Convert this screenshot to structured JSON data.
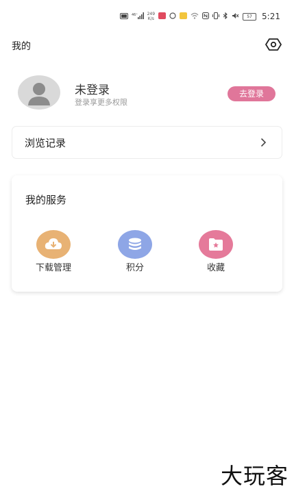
{
  "status_bar": {
    "signal": "46⁺",
    "net_speed": "249\nK/s",
    "battery": "57",
    "time": "5:21"
  },
  "header": {
    "title": "我的",
    "visibility_icon": "eye-icon"
  },
  "profile": {
    "avatar_icon": "user-avatar-icon",
    "title": "未登录",
    "subtitle": "登录享更多权限",
    "login_button": "去登录"
  },
  "history": {
    "label": "浏览记录",
    "arrow_icon": "chevron-right-icon"
  },
  "services": {
    "title": "我的服务",
    "items": [
      {
        "label": "下载管理",
        "icon": "download-icon",
        "color": "#e8b274"
      },
      {
        "label": "积分",
        "icon": "coins-icon",
        "color": "#8ea6e6"
      },
      {
        "label": "收藏",
        "icon": "favorite-folder-icon",
        "color": "#e57a9a"
      }
    ]
  },
  "colors": {
    "accent": "#e0769a",
    "card_border": "#ececec"
  },
  "watermark": "大玩客"
}
